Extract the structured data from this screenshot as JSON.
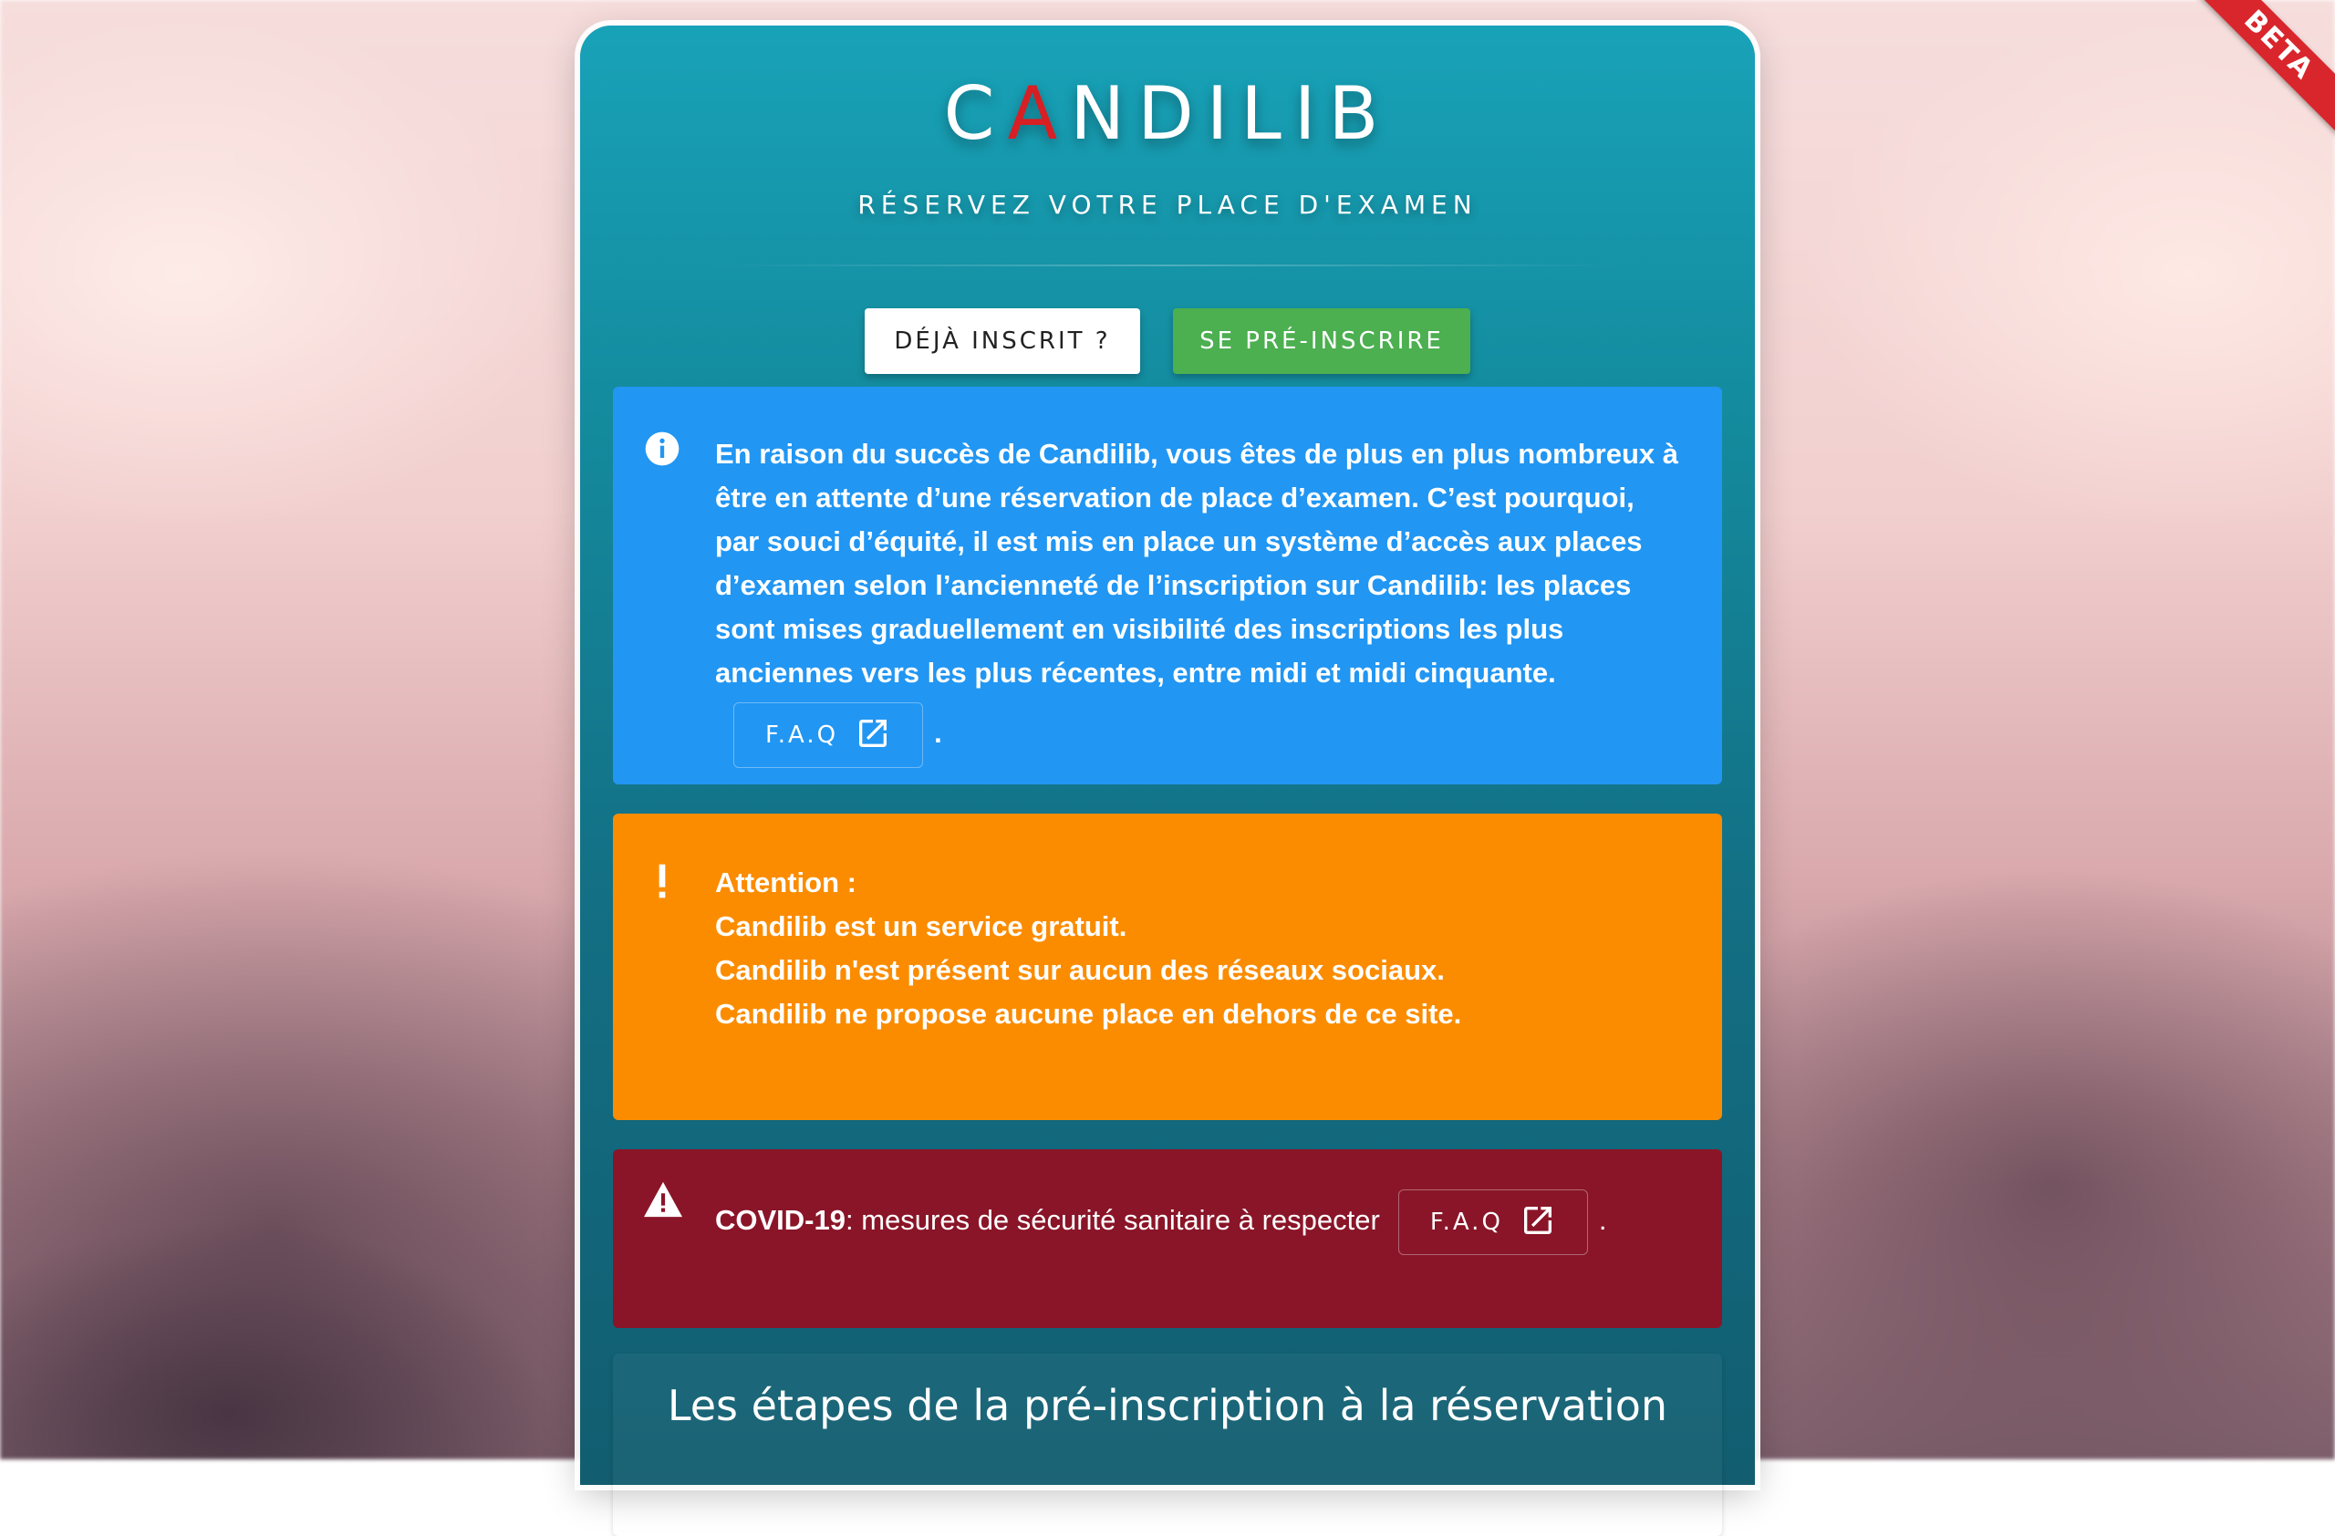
{
  "header": {
    "logo_first": "C",
    "logo_accent": "A",
    "logo_rest": "NDILIB",
    "subtitle": "RÉSERVEZ VOTRE PLACE D'EXAMEN",
    "ribbon": "BETA"
  },
  "actions": {
    "login_label": "DÉJÀ INSCRIT ?",
    "register_label": "SE PRÉ-INSCRIRE"
  },
  "alerts": {
    "info": {
      "icon": "info-circle-icon",
      "text": "En raison du succès de Candilib, vous êtes de plus en plus nombreux à être en attente d’une réservation de place d’examen. C’est pourquoi, par souci d’équité, il est mis en place un système d’accès aux places d’examen selon l’ancienneté de l’inscription sur Candilib: les places sont mises graduellement en visibilité des inscriptions les plus anciennes vers les plus récentes, entre midi et midi cinquante.",
      "faq_label": "F.A.Q",
      "suffix": "."
    },
    "warning": {
      "icon": "exclamation-icon",
      "lines": [
        "Attention :",
        "Candilib est un service gratuit.",
        "Candilib n'est présent sur aucun des réseaux sociaux.",
        "Candilib ne propose aucune place en dehors de ce site."
      ]
    },
    "covid": {
      "icon": "warning-triangle-icon",
      "label": "COVID-19",
      "text": ": mesures de sécurité sanitaire à respecter",
      "faq_label": "F.A.Q",
      "suffix": "."
    }
  },
  "steps": {
    "title": "Les étapes de la pré-inscription à la réservation"
  },
  "colors": {
    "card_top": "#18a2b8",
    "card_bottom": "#125d70",
    "info": "#2196f3",
    "warning": "#fb8c00",
    "error": "#8a1528",
    "register": "#4caf50",
    "accent": "#d71f24"
  }
}
